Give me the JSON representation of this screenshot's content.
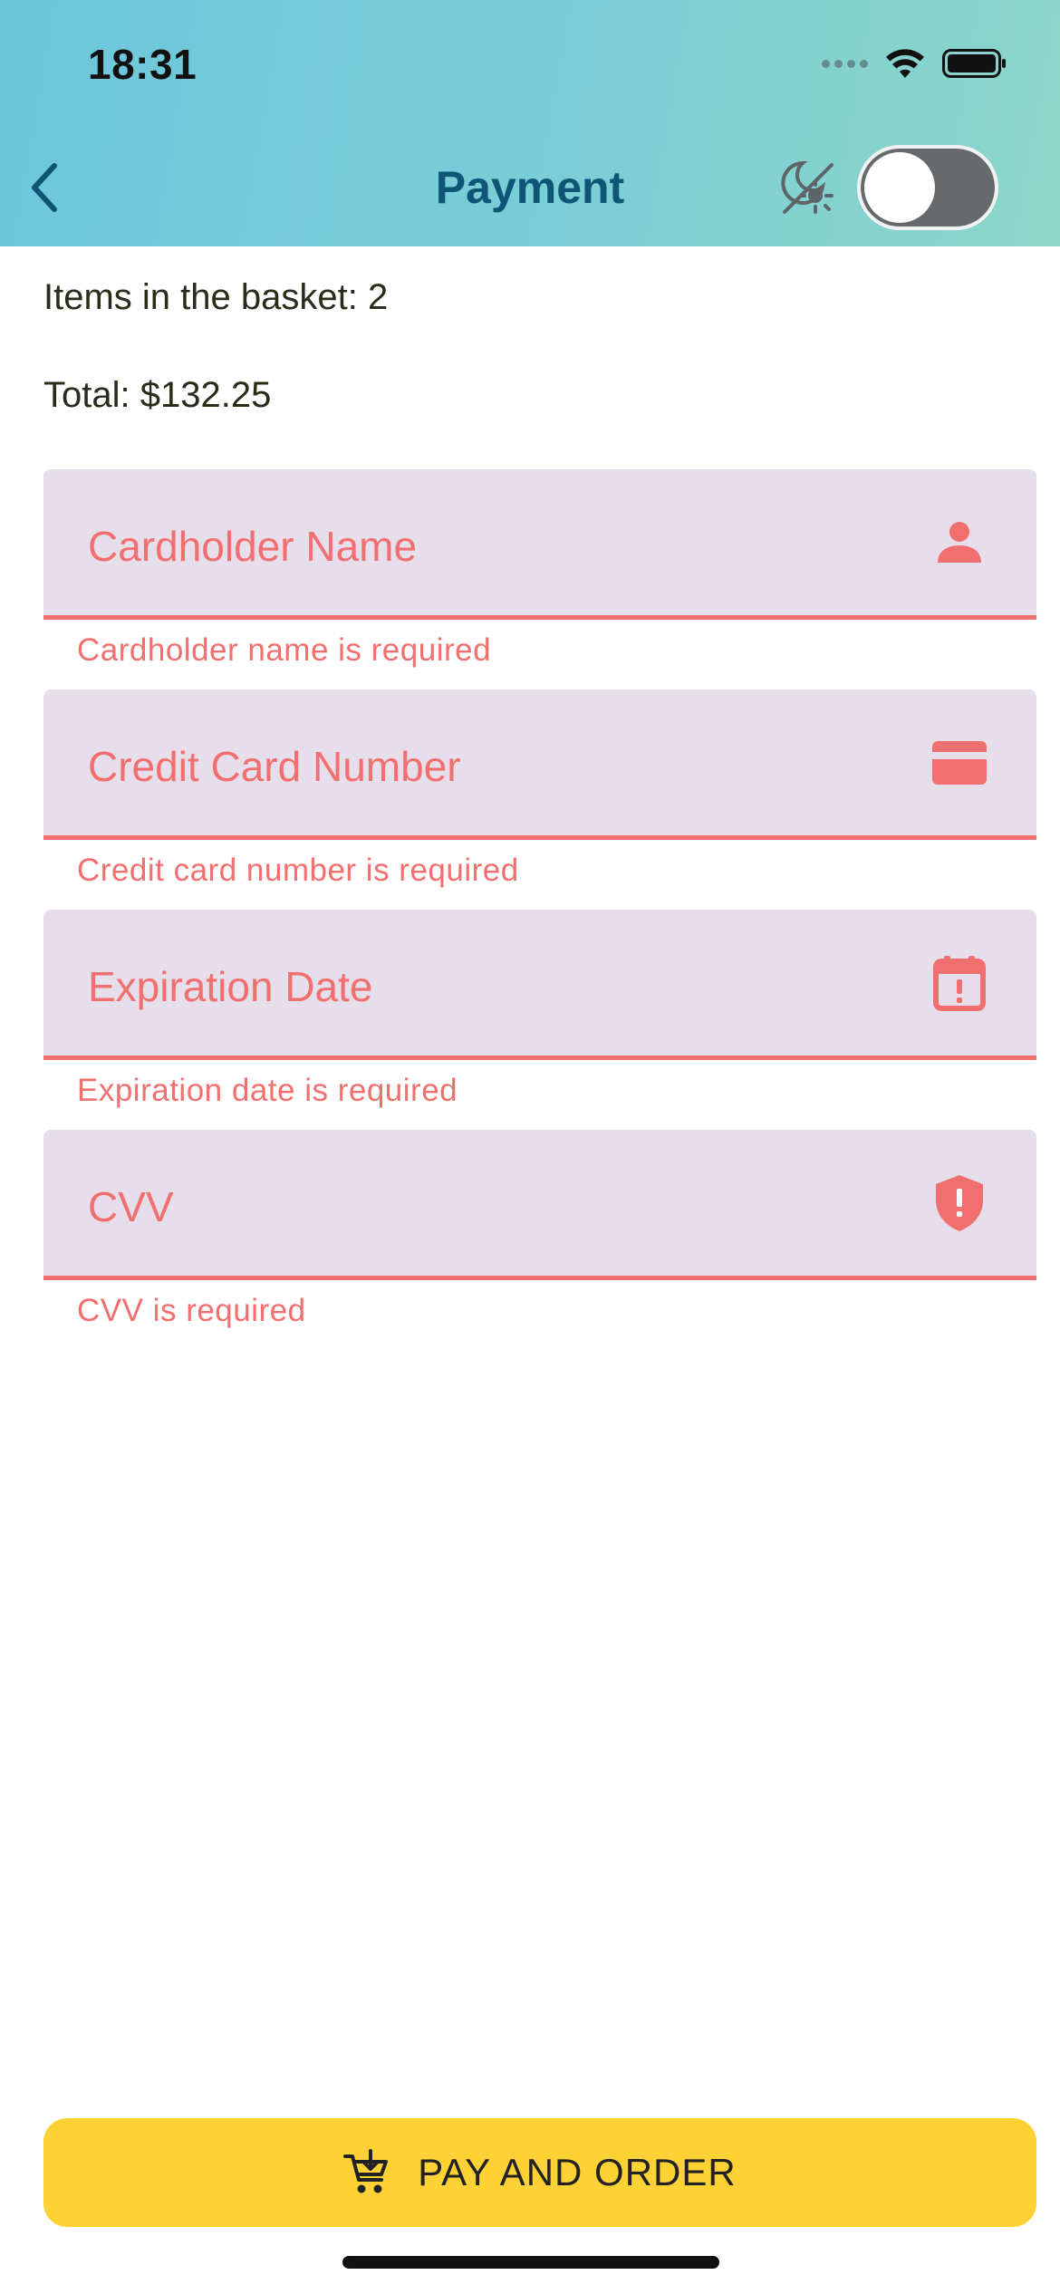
{
  "status_bar": {
    "time": "18:31"
  },
  "header": {
    "title": "Payment",
    "back_icon": "chevron-left-icon",
    "theme_icon": "day-night-icon",
    "dark_mode_toggle": false
  },
  "summary": {
    "items_text": "Items in the basket:  2",
    "total_text": "Total: $132.25"
  },
  "form": {
    "fields": [
      {
        "label": "Cardholder Name",
        "icon": "person-icon",
        "error": "Cardholder name is required"
      },
      {
        "label": "Credit Card Number",
        "icon": "credit-card-icon",
        "error": "Credit card number is required"
      },
      {
        "label": "Expiration Date",
        "icon": "calendar-alert-icon",
        "error": "Expiration date is required"
      },
      {
        "label": "CVV",
        "icon": "shield-alert-icon",
        "error": "CVV is required"
      }
    ]
  },
  "pay_button": {
    "label": "PAY AND ORDER",
    "icon": "cart-add-icon"
  },
  "colors": {
    "header_gradient_start": "#6cc6dc",
    "header_gradient_end": "#8dd6c9",
    "title": "#0f5576",
    "error": "#f26f6f",
    "field_background": "#e7deec",
    "button": "#fed134"
  }
}
